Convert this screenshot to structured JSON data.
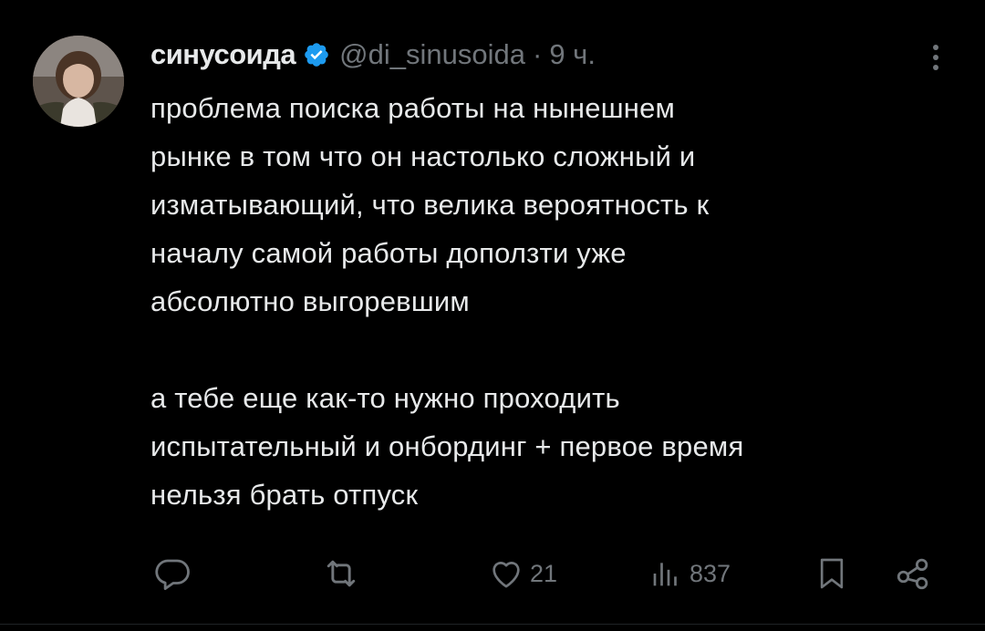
{
  "author": {
    "display_name": "синусоида",
    "handle": "@di_sinusoida",
    "separator": "·",
    "time": "9 ч."
  },
  "tweet": {
    "lines_p1": [
      "проблема поиска работы на нынешнем",
      "рынке в том что он настолько сложный и",
      "изматывающий, что велика вероятность к",
      "началу самой работы доползти уже",
      "абсолютно выгоревшим"
    ],
    "lines_p2": [
      "а тебе еще как-то нужно проходить",
      "испытательный и онбординг + первое время",
      "нельзя брать отпуск"
    ]
  },
  "actions": {
    "reply_count": "",
    "retweet_count": "",
    "like_count": "21",
    "views_count": "837"
  },
  "icons": {
    "verified": "verified-badge-icon",
    "more": "more-vertical-icon",
    "reply": "reply-icon",
    "retweet": "retweet-icon",
    "like": "heart-icon",
    "views": "views-icon",
    "bookmark": "bookmark-icon",
    "share": "share-icon"
  },
  "colors": {
    "background": "#000000",
    "text": "#e7e9ea",
    "muted": "#71767b",
    "verified": "#1d9bf0"
  }
}
